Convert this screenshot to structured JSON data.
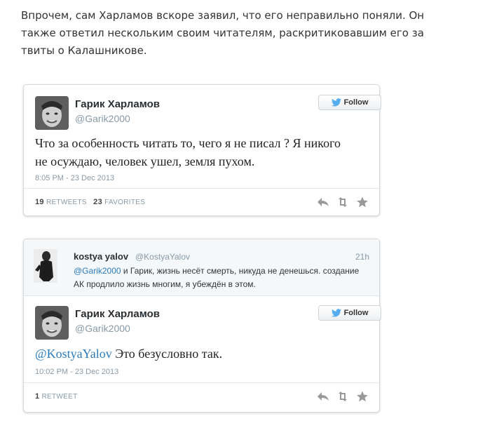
{
  "article": {
    "paragraph": "Впрочем, сам Харламов вскоре заявил, что его неправильно поняли. Он также ответил нескольким своим читателям, раскритиковавшим его за твиты о Калашникове."
  },
  "tweet1": {
    "name": "Гарик Харламов",
    "handle": "@Garik2000",
    "follow_label": "Follow",
    "text": "Что за особенность читать то, чего я не писал ? Я никого не осуждаю, человек ушел, земля пухом.",
    "timestamp": "8:05 PM - 23 Dec 2013",
    "retweets_count": "19",
    "retweets_label": "RETWEETS",
    "favorites_count": "23",
    "favorites_label": "FAVORITES"
  },
  "reply_to": {
    "name": "kostya yalov",
    "handle": "@KostyaYalov",
    "time": "21h",
    "mention": "@Garik2000",
    "text": " и Гарик, жизнь несёт смерть, никуда не денешься. создание АК продлило жизнь многим, я убеждён в этом."
  },
  "tweet2": {
    "name": "Гарик Харламов",
    "handle": "@Garik2000",
    "follow_label": "Follow",
    "mention": "@KostyaYalov",
    "text": " Это безусловно так.",
    "timestamp": "10:02 PM - 23 Dec 2013",
    "retweets_count": "1",
    "retweets_label": "RETWEET"
  },
  "icons": {
    "twitter_bird": "twitter-bird-icon",
    "reply": "reply-icon",
    "retweet": "retweet-icon",
    "favorite": "star-icon"
  },
  "colors": {
    "link": "#2b7bb9",
    "muted": "#8899a6",
    "twitter_blue": "#55acee"
  }
}
